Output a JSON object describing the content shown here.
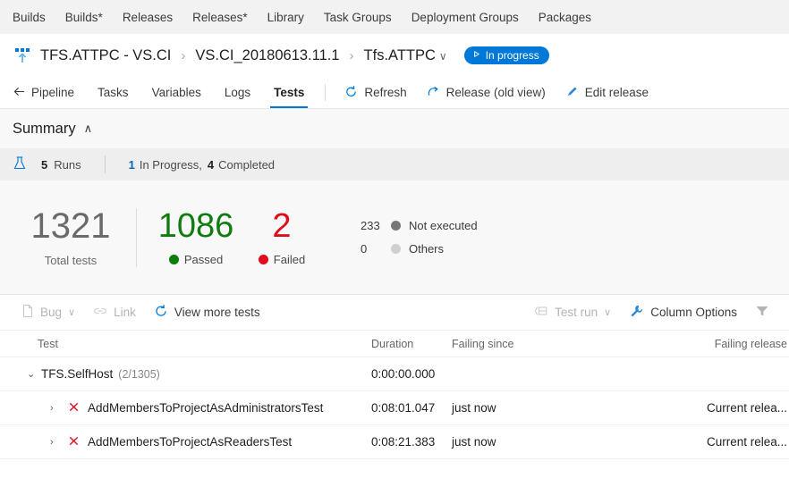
{
  "topnav": {
    "items": [
      {
        "label": "Builds"
      },
      {
        "label": "Builds*"
      },
      {
        "label": "Releases"
      },
      {
        "label": "Releases*"
      },
      {
        "label": "Library"
      },
      {
        "label": "Task Groups"
      },
      {
        "label": "Deployment Groups"
      },
      {
        "label": "Packages"
      }
    ]
  },
  "breadcrumb": {
    "release_icon": "release-icon",
    "definition": "TFS.ATTPC - VS.CI",
    "separator": "›",
    "release": "VS.CI_20180613.11.1",
    "environment": "Tfs.ATTPC",
    "environment_chevron": "∨",
    "status_badge": {
      "label": "In progress",
      "icon": "play-icon",
      "color": "#0078d7"
    }
  },
  "tabs": {
    "back_icon": "back-arrow-icon",
    "items": [
      {
        "label": "Pipeline",
        "active": false
      },
      {
        "label": "Tasks",
        "active": false
      },
      {
        "label": "Variables",
        "active": false
      },
      {
        "label": "Logs",
        "active": false
      },
      {
        "label": "Tests",
        "active": true
      }
    ],
    "actions": [
      {
        "label": "Refresh",
        "icon": "refresh-icon"
      },
      {
        "label": "Release (old view)",
        "icon": "redirect-icon"
      },
      {
        "label": "Edit release",
        "icon": "pencil-icon"
      }
    ]
  },
  "summary": {
    "title": "Summary",
    "collapse_chevron": "∧",
    "runs": {
      "icon": "flask-icon",
      "count": "5",
      "label": "Runs",
      "in_progress_count": "1",
      "in_progress_label": "In Progress,",
      "completed_count": "4",
      "completed_label": "Completed"
    },
    "stats": {
      "total": {
        "value": "1321",
        "label": "Total tests"
      },
      "passed": {
        "value": "1086",
        "label": "Passed",
        "color": "#107c10"
      },
      "failed": {
        "value": "2",
        "label": "Failed",
        "color": "#e00b1c"
      },
      "not_executed": {
        "value": "233",
        "label": "Not executed",
        "color": "#767676"
      },
      "others": {
        "value": "0",
        "label": "Others",
        "color": "#cfcfcf"
      }
    }
  },
  "gridbar": {
    "bug": {
      "label": "Bug",
      "icon": "bug-file-icon",
      "chevron": "∨"
    },
    "link": {
      "label": "Link",
      "icon": "link-icon"
    },
    "view_more": {
      "label": "View more tests",
      "icon": "refresh-circle-icon"
    },
    "test_run": {
      "label": "Test run",
      "icon": "test-run-icon",
      "chevron": "∨"
    },
    "column_options": {
      "label": "Column Options",
      "icon": "wrench-icon"
    },
    "filter": {
      "icon": "filter-icon"
    }
  },
  "table": {
    "columns": {
      "test": "Test",
      "duration": "Duration",
      "failing_since": "Failing since",
      "failing_release": "Failing release"
    },
    "rows": [
      {
        "type": "group",
        "chevron": "⌄",
        "name": "TFS.SelfHost",
        "counts": "(2/1305)",
        "duration": "0:00:00.000",
        "failing_since": "",
        "failing_release": ""
      },
      {
        "type": "child",
        "chevron": "›",
        "status_icon": "failed-x-icon",
        "name": "AddMembersToProjectAsAdministratorsTest",
        "duration": "0:08:01.047",
        "failing_since": "just now",
        "failing_release": "Current relea..."
      },
      {
        "type": "child",
        "chevron": "›",
        "status_icon": "failed-x-icon",
        "name": "AddMembersToProjectAsReadersTest",
        "duration": "0:08:21.383",
        "failing_since": "just now",
        "failing_release": "Current relea..."
      }
    ]
  }
}
